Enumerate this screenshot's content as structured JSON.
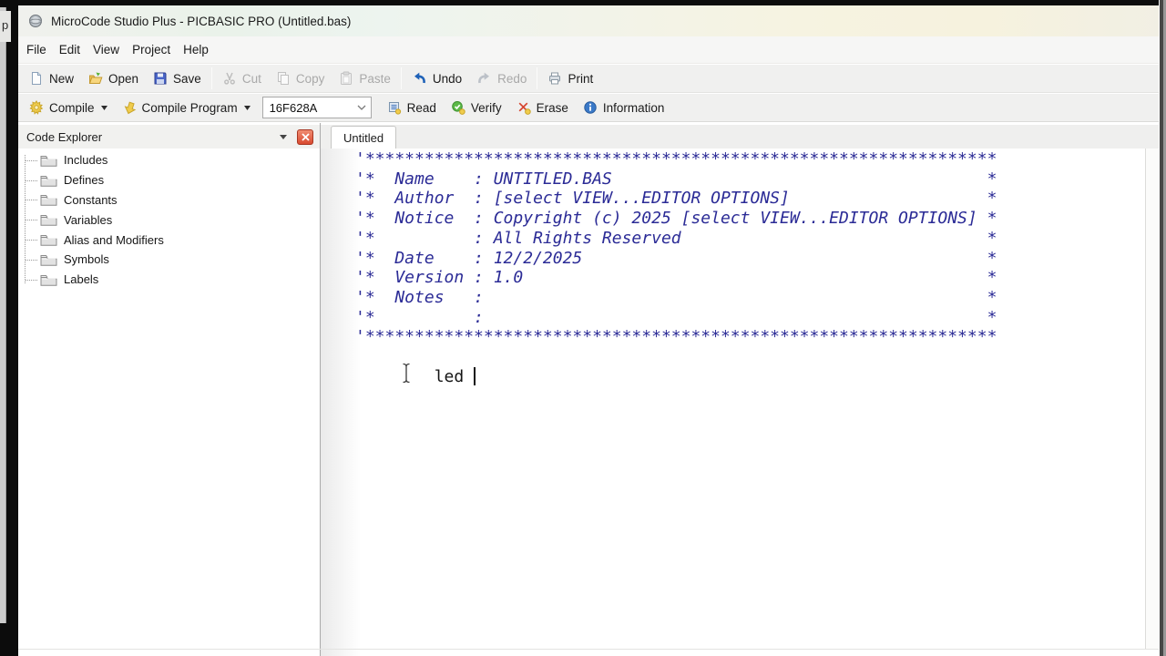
{
  "background": {
    "partial_text": "p"
  },
  "window": {
    "title": "MicroCode Studio Plus - PICBASIC PRO (Untitled.bas)"
  },
  "menubar": {
    "items": [
      "File",
      "Edit",
      "View",
      "Project",
      "Help"
    ]
  },
  "toolbar_file": {
    "new": {
      "label": "New",
      "enabled": true
    },
    "open": {
      "label": "Open",
      "enabled": true
    },
    "save": {
      "label": "Save",
      "enabled": true
    },
    "cut": {
      "label": "Cut",
      "enabled": false
    },
    "copy": {
      "label": "Copy",
      "enabled": false
    },
    "paste": {
      "label": "Paste",
      "enabled": false
    },
    "undo": {
      "label": "Undo",
      "enabled": true
    },
    "redo": {
      "label": "Redo",
      "enabled": false
    },
    "print": {
      "label": "Print",
      "enabled": true
    }
  },
  "toolbar_compile": {
    "compile": {
      "label": "Compile"
    },
    "compile_program": {
      "label": "Compile Program"
    },
    "device_select": {
      "value": "16F628A"
    },
    "read": {
      "label": "Read"
    },
    "verify": {
      "label": "Verify"
    },
    "erase": {
      "label": "Erase"
    },
    "information": {
      "label": "Information"
    }
  },
  "code_explorer": {
    "title": "Code Explorer",
    "items": [
      "Includes",
      "Defines",
      "Constants",
      "Variables",
      "Alias and Modifiers",
      "Symbols",
      "Labels"
    ]
  },
  "editor": {
    "tab_label": "Untitled",
    "comment_color": "#2b2b96",
    "comment_lines": [
      "'****************************************************************",
      "'*  Name    : UNTITLED.BAS                                      *",
      "'*  Author  : [select VIEW...EDITOR OPTIONS]                    *",
      "'*  Notice  : Copyright (c) 2025 [select VIEW...EDITOR OPTIONS] *",
      "'*          : All Rights Reserved                               *",
      "'*  Date    : 12/2/2025                                         *",
      "'*  Version : 1.0                                               *",
      "'*  Notes   :                                                   *",
      "'*          :                                                   *",
      "'****************************************************************"
    ],
    "typed_text": "led "
  }
}
